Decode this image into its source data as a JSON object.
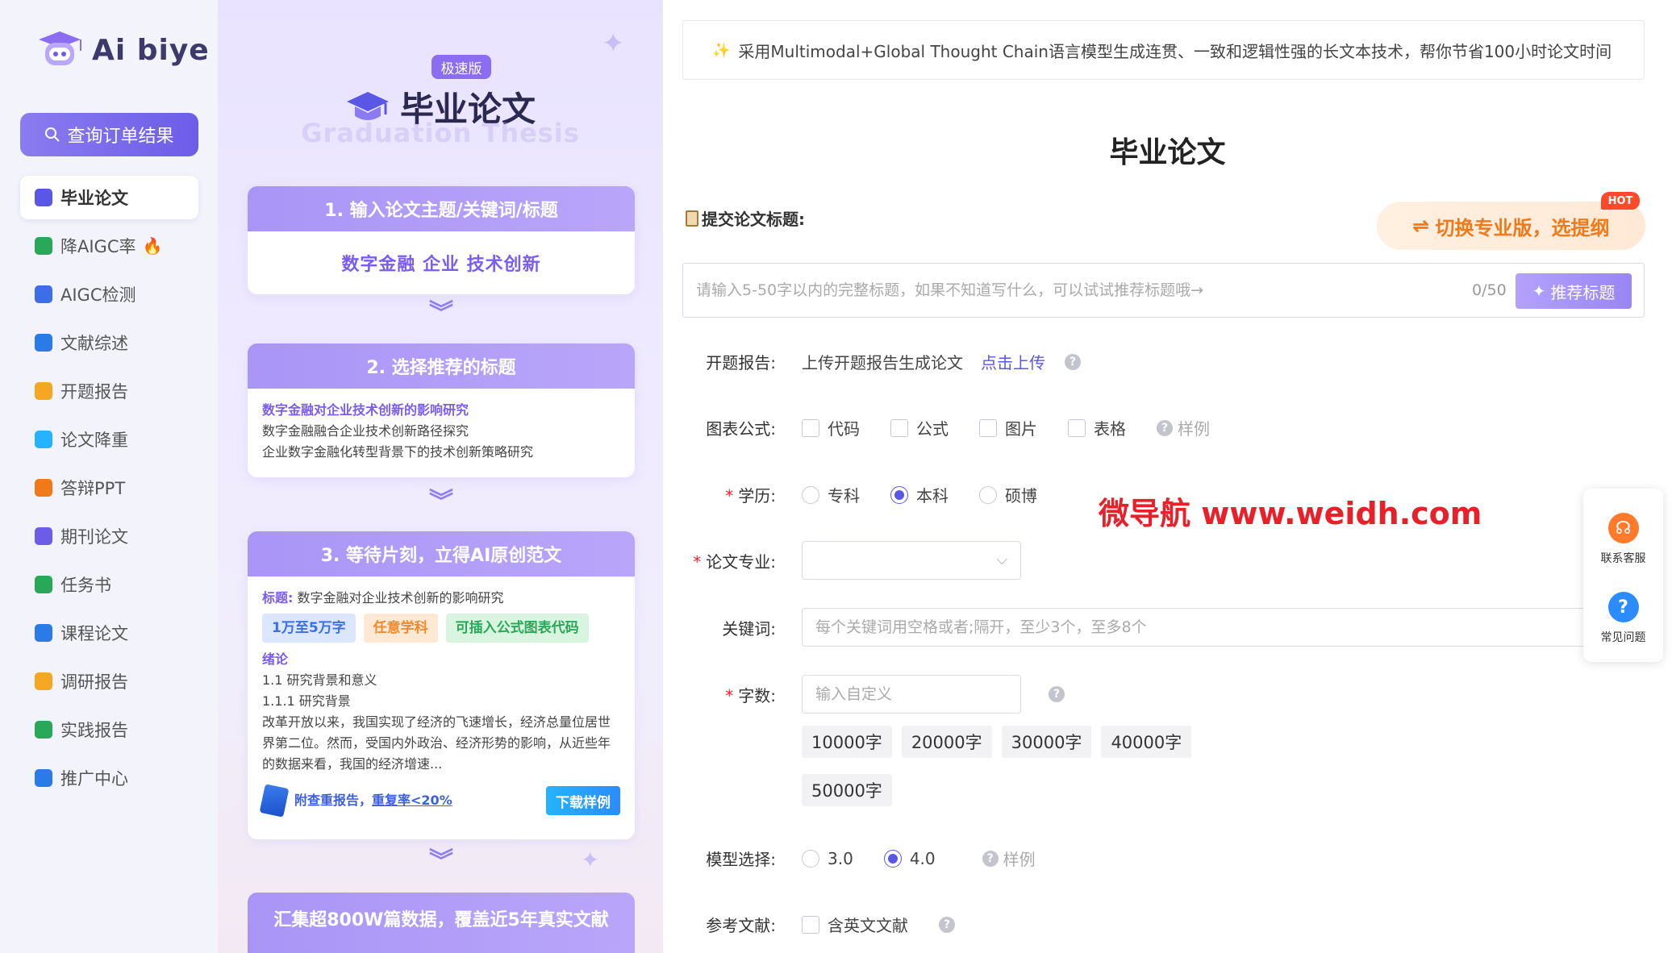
{
  "app": {
    "logo_text": "Ai biye"
  },
  "sidebar": {
    "query_button": "查询订单结果",
    "items": [
      {
        "label": "毕业论文",
        "icon": "graduation-cap-icon",
        "color": "#5b57e6",
        "active": true
      },
      {
        "label": "降AIGC率",
        "icon": "ai-badge-icon",
        "color": "#2aa85a",
        "hot": true
      },
      {
        "label": "AIGC检测",
        "icon": "ai-detect-icon",
        "color": "#3c6ee8"
      },
      {
        "label": "文献综述",
        "icon": "book-icon",
        "color": "#2a7be8"
      },
      {
        "label": "开题报告",
        "icon": "report-icon",
        "color": "#f5a623"
      },
      {
        "label": "论文降重",
        "icon": "chart-down-icon",
        "color": "#25b3ff"
      },
      {
        "label": "答辩PPT",
        "icon": "ppt-icon",
        "color": "#f07a1a"
      },
      {
        "label": "期刊论文",
        "icon": "journal-icon",
        "color": "#6d5ce8"
      },
      {
        "label": "任务书",
        "icon": "task-icon",
        "color": "#2aa85a"
      },
      {
        "label": "课程论文",
        "icon": "course-icon",
        "color": "#2a7be8"
      },
      {
        "label": "调研报告",
        "icon": "survey-icon",
        "color": "#f5a623"
      },
      {
        "label": "实践报告",
        "icon": "practice-icon",
        "color": "#2aa85a"
      },
      {
        "label": "推广中心",
        "icon": "paper-plane-icon",
        "color": "#2a7be8"
      }
    ]
  },
  "promo": {
    "badge": "极速版",
    "title": "毕业论文",
    "subtitle": "Graduation Thesis",
    "step1": {
      "head": "1. 输入论文主题/关键词/标题",
      "body": "数字金融 企业 技术创新"
    },
    "step2": {
      "head": "2. 选择推荐的标题",
      "lines": [
        "数字金融对企业技术创新的影响研究",
        "数字金融融合企业技术创新路径探究",
        "企业数字金融化转型背景下的技术创新策略研究"
      ]
    },
    "step3": {
      "head": "3. 等待片刻，立得AI原创范文",
      "title_label": "标题:",
      "title_value": "数字金融对企业技术创新的影响研究",
      "tags": [
        "1万至5万字",
        "任意学科",
        "可插入公式图表代码"
      ],
      "section": "绪论",
      "line1": "1.1 研究背景和意义",
      "line2": "1.1.1 研究背景",
      "paragraph": "改革开放以来，我国实现了经济的飞速增长，经济总量位居世界第二位。然而，受国内外政治、经济形势的影响，从近些年的数据来看，我国的经济增速...",
      "foot_text_a": "附查重报告，",
      "foot_text_b": "重复率<20%",
      "download": "下载样例"
    },
    "bottom": "汇集超800W篇数据，覆盖近5年真实文献"
  },
  "main": {
    "banner": "采用Multimodal+Global Thought Chain语言模型生成连贯、一致和逻辑性强的长文本技术，帮你节省100小时论文时间",
    "title": "毕业论文",
    "submit_label": "提交论文标题:",
    "pro_button": "切换专业版，选提纲",
    "hot": "HOT",
    "title_placeholder": "请输入5-50字以内的完整标题，如果不知道写什么，可以试试推荐标题哦→",
    "counter": "0/50",
    "recommend_button": "推荐标题",
    "proposal": {
      "label": "开题报告:",
      "text": "上传开题报告生成论文",
      "link": "点击上传"
    },
    "charts": {
      "label": "图表公式:",
      "options": [
        "代码",
        "公式",
        "图片",
        "表格"
      ],
      "sample": "样例"
    },
    "degree": {
      "label": "学历:",
      "options": [
        "专科",
        "本科",
        "硕博"
      ],
      "selected": "本科"
    },
    "major": {
      "label": "论文专业:"
    },
    "keywords": {
      "label": "关键词:",
      "placeholder": "每个关键词用空格或者;隔开，至少3个，至多8个"
    },
    "words": {
      "label": "字数:",
      "placeholder": "输入自定义",
      "chips": [
        "10000字",
        "20000字",
        "30000字",
        "40000字",
        "50000字"
      ]
    },
    "model": {
      "label": "模型选择:",
      "options": [
        "3.0",
        "4.0"
      ],
      "selected": "4.0",
      "sample": "样例"
    },
    "refs": {
      "label": "参考文献:",
      "option": "含英文文献"
    },
    "watermark": "微导航 www.weidh.com",
    "float": {
      "service": "联系客服",
      "faq": "常见问题"
    }
  }
}
